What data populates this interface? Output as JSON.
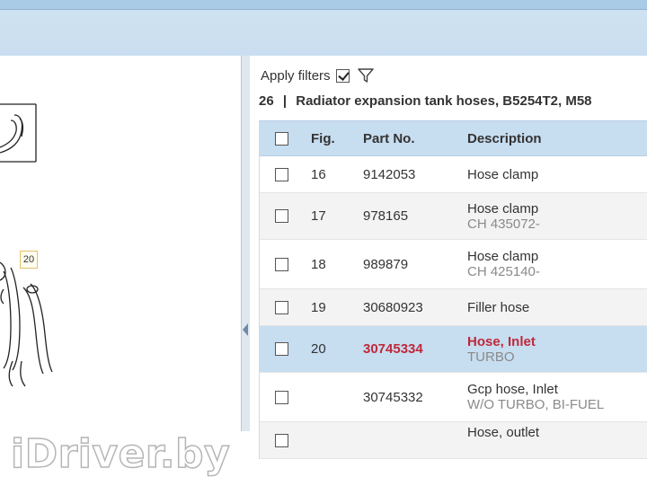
{
  "filters": {
    "label": "Apply filters",
    "checked": true,
    "icon": "filter-icon"
  },
  "group": {
    "number": "26",
    "separator": "|",
    "title": "Radiator expansion tank hoses, B5254T2, M58"
  },
  "table": {
    "headers": {
      "fig": "Fig.",
      "part": "Part No.",
      "desc": "Description"
    },
    "rows": [
      {
        "fig": "16",
        "part": "9142053",
        "desc": "Hose clamp",
        "note": ""
      },
      {
        "fig": "17",
        "part": "978165",
        "desc": "Hose clamp",
        "note": "CH 435072-"
      },
      {
        "fig": "18",
        "part": "989879",
        "desc": "Hose clamp",
        "note": "CH 425140-"
      },
      {
        "fig": "19",
        "part": "30680923",
        "desc": "Filler hose",
        "note": ""
      },
      {
        "fig": "20",
        "part": "30745334",
        "desc": "Hose, Inlet",
        "note": "TURBO",
        "selected": true
      },
      {
        "fig": "",
        "part": "30745332",
        "desc": "Gcp hose, Inlet",
        "note": "W/O TURBO, BI-FUEL"
      },
      {
        "fig": "",
        "part": "",
        "desc": "Hose, outlet",
        "note": ""
      }
    ]
  },
  "diagram": {
    "callout": "20"
  },
  "watermark": "iDriver.by",
  "colors": {
    "header_bg": "#c7ddf0",
    "selected_bg": "#c7ddf0",
    "selected_text": "#c0283a",
    "topbar": "#c9def0"
  }
}
